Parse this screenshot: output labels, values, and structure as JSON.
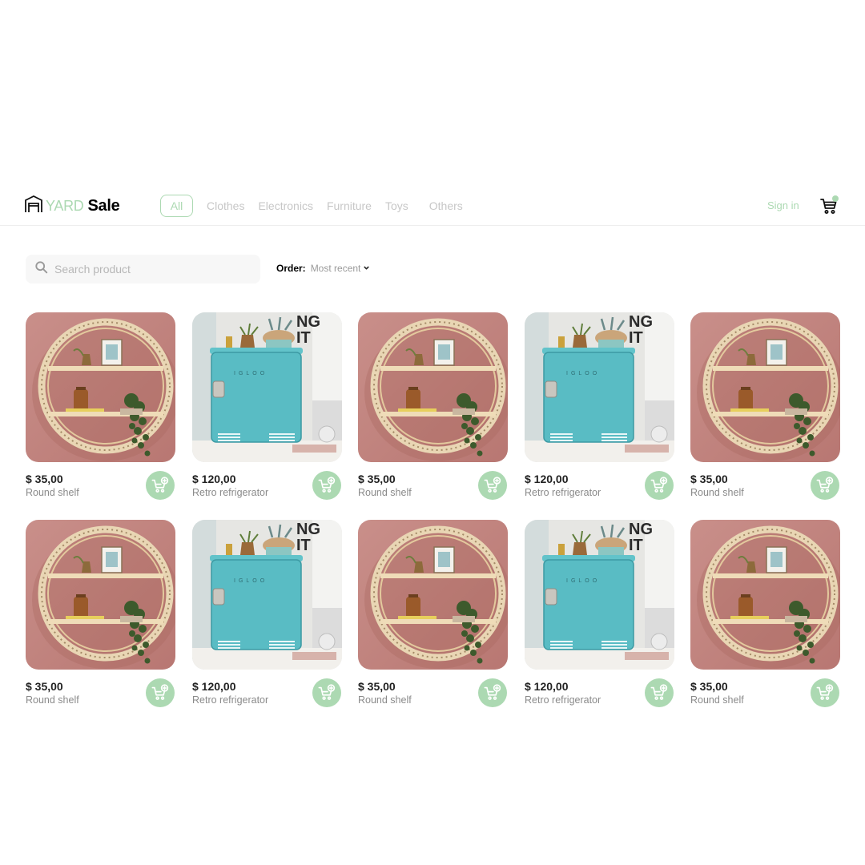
{
  "brand": {
    "part1": "YARD",
    "part2": "Sale"
  },
  "nav": {
    "items": [
      {
        "label": "All",
        "active": true
      },
      {
        "label": "Clothes"
      },
      {
        "label": "Electronics"
      },
      {
        "label": "Furniture"
      },
      {
        "label": "Toys"
      },
      {
        "label": "Others"
      }
    ],
    "signin": "Sign in"
  },
  "search": {
    "placeholder": "Search product",
    "value": ""
  },
  "order": {
    "label": "Order:",
    "value": "Most recent"
  },
  "colors": {
    "accent": "#acd9b2",
    "shelf_wall": "#c98f8a",
    "fridge": "#5bc0c8"
  },
  "products": [
    {
      "price": "$ 35,00",
      "name": "Round shelf",
      "image": "round-shelf"
    },
    {
      "price": "$ 120,00",
      "name": "Retro refrigerator",
      "image": "retro-fridge"
    },
    {
      "price": "$ 35,00",
      "name": "Round shelf",
      "image": "round-shelf"
    },
    {
      "price": "$ 120,00",
      "name": "Retro refrigerator",
      "image": "retro-fridge"
    },
    {
      "price": "$ 35,00",
      "name": "Round shelf",
      "image": "round-shelf"
    },
    {
      "price": "$ 35,00",
      "name": "Round shelf",
      "image": "round-shelf"
    },
    {
      "price": "$ 120,00",
      "name": "Retro refrigerator",
      "image": "retro-fridge"
    },
    {
      "price": "$ 35,00",
      "name": "Round shelf",
      "image": "round-shelf"
    },
    {
      "price": "$ 120,00",
      "name": "Retro refrigerator",
      "image": "retro-fridge"
    },
    {
      "price": "$ 35,00",
      "name": "Round shelf",
      "image": "round-shelf"
    }
  ]
}
